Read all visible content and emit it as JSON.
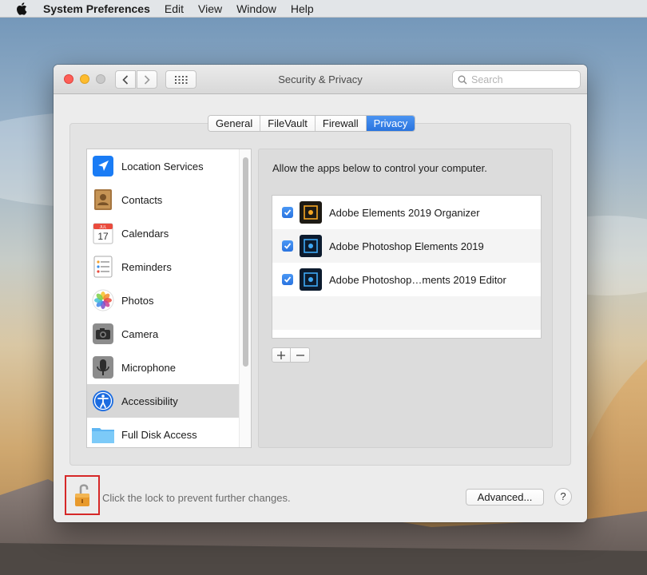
{
  "menubar": {
    "app_name": "System Preferences",
    "items": [
      "Edit",
      "View",
      "Window",
      "Help"
    ]
  },
  "window": {
    "title": "Security & Privacy",
    "search_placeholder": "Search"
  },
  "tabs": [
    {
      "label": "General",
      "active": false
    },
    {
      "label": "FileVault",
      "active": false
    },
    {
      "label": "Firewall",
      "active": false
    },
    {
      "label": "Privacy",
      "active": true
    }
  ],
  "sidebar": {
    "items": [
      {
        "label": "Location Services",
        "icon": "location-arrow-icon"
      },
      {
        "label": "Contacts",
        "icon": "contacts-book-icon"
      },
      {
        "label": "Calendars",
        "icon": "calendar-icon",
        "icon_text": [
          "JUL",
          "17"
        ]
      },
      {
        "label": "Reminders",
        "icon": "reminders-list-icon"
      },
      {
        "label": "Photos",
        "icon": "photos-flower-icon"
      },
      {
        "label": "Camera",
        "icon": "camera-icon"
      },
      {
        "label": "Microphone",
        "icon": "microphone-icon"
      },
      {
        "label": "Accessibility",
        "icon": "accessibility-person-icon",
        "selected": true
      },
      {
        "label": "Full Disk Access",
        "icon": "folder-icon"
      }
    ]
  },
  "panel": {
    "caption": "Allow the apps below to control your computer.",
    "apps": [
      {
        "label": "Adobe Elements 2019 Organizer",
        "checked": true,
        "icon": "adobe-organizer-icon"
      },
      {
        "label": "Adobe Photoshop Elements 2019",
        "checked": true,
        "icon": "adobe-photoshop-elements-icon"
      },
      {
        "label": "Adobe Photoshop…ments 2019 Editor",
        "checked": true,
        "icon": "adobe-photoshop-editor-icon"
      }
    ],
    "add_label": "+",
    "remove_label": "−"
  },
  "footer": {
    "lock_text": "Click the lock to prevent further changes.",
    "advanced_label": "Advanced...",
    "help_label": "?"
  },
  "colors": {
    "accent": "#2a74de",
    "lock_highlight": "#d62828"
  }
}
